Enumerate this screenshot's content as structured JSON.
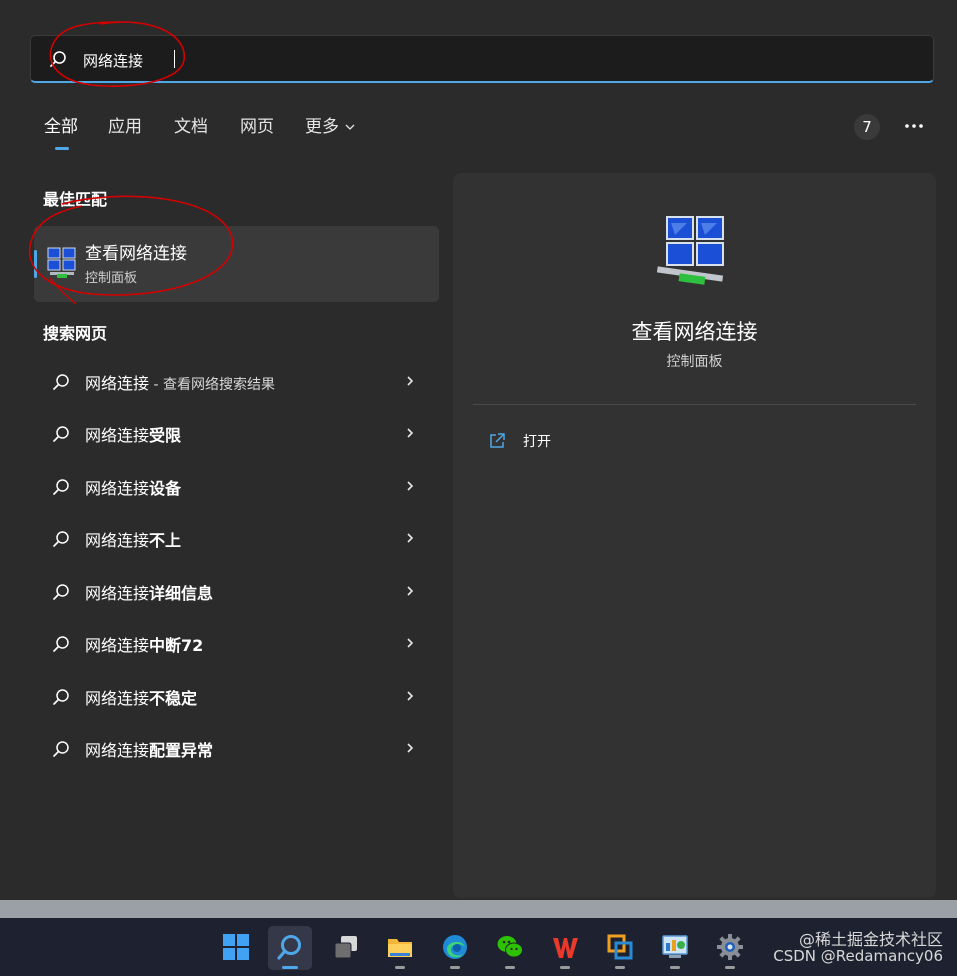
{
  "search": {
    "value": "网络连接",
    "placeholder": ""
  },
  "tabs": [
    {
      "label": "全部"
    },
    {
      "label": "应用"
    },
    {
      "label": "文档"
    },
    {
      "label": "网页"
    },
    {
      "label": "更多"
    }
  ],
  "header": {
    "count": "7"
  },
  "best_match": {
    "heading": "最佳匹配",
    "title": "查看网络连接",
    "subtitle": "控制面板"
  },
  "web_search": {
    "heading": "搜索网页",
    "results": [
      {
        "base": "网络连接",
        "suffix": "",
        "note": " - 查看网络搜索结果"
      },
      {
        "base": "网络连接",
        "suffix": "受限",
        "note": ""
      },
      {
        "base": "网络连接",
        "suffix": "设备",
        "note": ""
      },
      {
        "base": "网络连接",
        "suffix": "不上",
        "note": ""
      },
      {
        "base": "网络连接",
        "suffix": "详细信息",
        "note": ""
      },
      {
        "base": "网络连接",
        "suffix": "中断72",
        "note": ""
      },
      {
        "base": "网络连接",
        "suffix": "不稳定",
        "note": ""
      },
      {
        "base": "网络连接",
        "suffix": "配置异常",
        "note": ""
      }
    ]
  },
  "preview": {
    "title": "查看网络连接",
    "subtitle": "控制面板",
    "actions": [
      {
        "label": "打开",
        "icon": "open-external-icon"
      }
    ]
  },
  "taskbar": {
    "items": [
      {
        "name": "start",
        "icon": "windows-logo-icon"
      },
      {
        "name": "search",
        "icon": "search-icon",
        "active": true
      },
      {
        "name": "task-view",
        "icon": "task-view-icon"
      },
      {
        "name": "file-explorer",
        "icon": "folder-icon"
      },
      {
        "name": "edge",
        "icon": "edge-browser-icon"
      },
      {
        "name": "wechat",
        "icon": "wechat-icon"
      },
      {
        "name": "wps",
        "icon": "wps-office-icon"
      },
      {
        "name": "virtualbox",
        "icon": "virtualbox-icon"
      },
      {
        "name": "control-panel",
        "icon": "control-panel-icon"
      },
      {
        "name": "settings",
        "icon": "gear-icon"
      }
    ]
  },
  "watermark": {
    "line1": "@稀土掘金技术社区",
    "line2": "CSDN @Redamancy06"
  },
  "colors": {
    "accent": "#4fa7e8",
    "annotation": "#d40000"
  }
}
